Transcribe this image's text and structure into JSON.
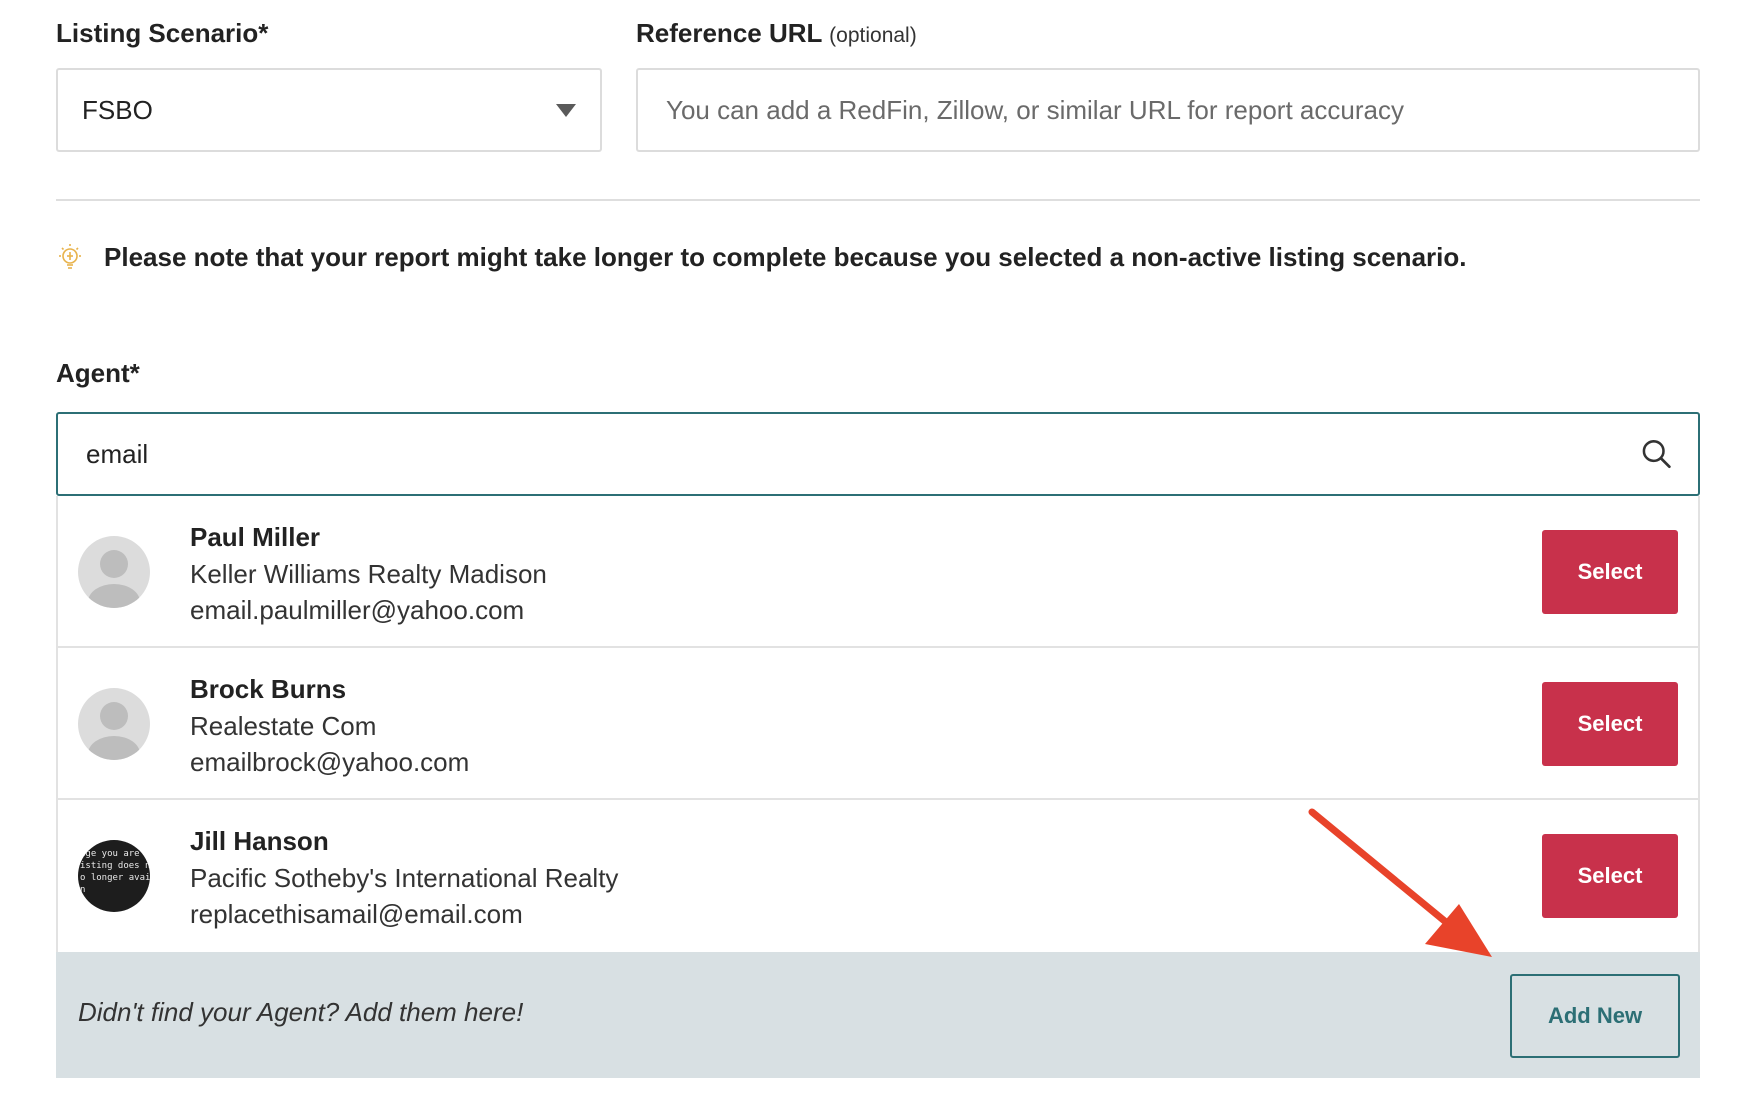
{
  "listing_scenario": {
    "label": "Listing Scenario*",
    "value": "FSBO"
  },
  "reference_url": {
    "label": "Reference URL",
    "optional": "(optional)",
    "placeholder": "You can add a RedFin, Zillow, or similar URL for report accuracy",
    "value": ""
  },
  "note": {
    "text": "Please note that your report might take longer to complete because you selected a non-active listing scenario.",
    "icon": "lightbulb-icon"
  },
  "agent": {
    "label": "Agent*",
    "search_value": "email",
    "search_icon": "search-icon",
    "results": [
      {
        "name": "Paul Miller",
        "company": "Keller Williams Realty Madison",
        "email": "email.paulmiller@yahoo.com",
        "button": "Select"
      },
      {
        "name": "Brock Burns",
        "company": "Realestate Com",
        "email": "emailbrock@yahoo.com",
        "button": "Select"
      },
      {
        "name": "Jill Hanson",
        "company": "Pacific Sotheby's International Realty",
        "email": "replacethisamail@email.com",
        "button": "Select"
      }
    ],
    "jill_avatar_text": [
      "age you are",
      "isting does no",
      "o longer avail",
      "n"
    ],
    "footer_text": "Didn't find your Agent? Add them here!",
    "add_new": "Add New"
  },
  "colors": {
    "accent": "#2c6f75",
    "select_button": "#c8314b",
    "footer_bg": "#d8e0e3",
    "arrow": "#e8432a"
  }
}
